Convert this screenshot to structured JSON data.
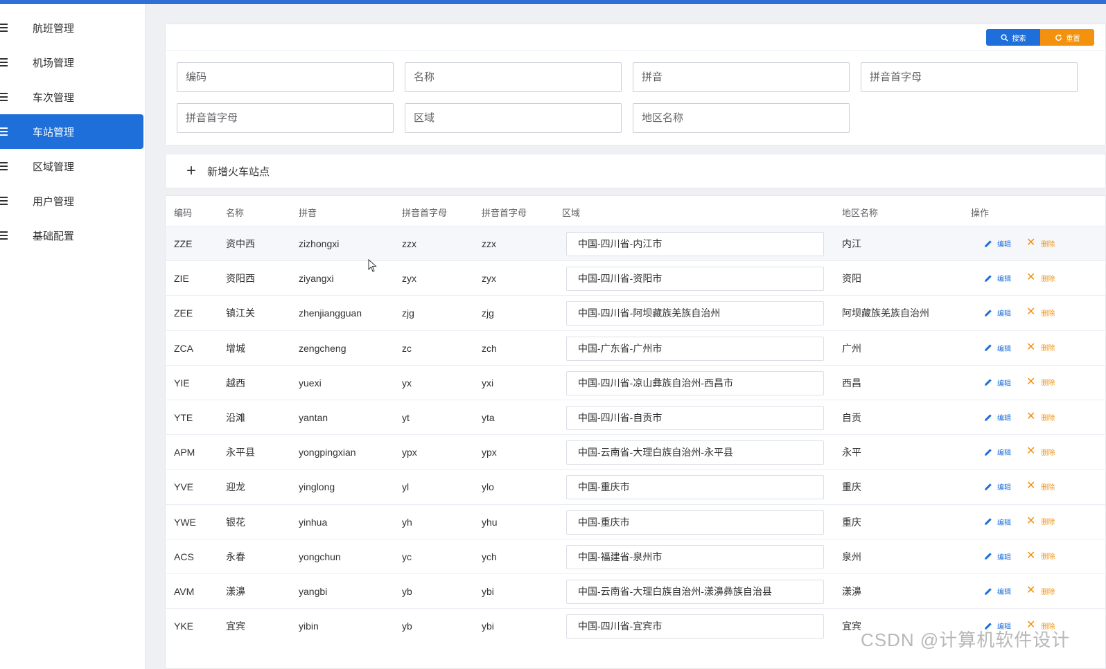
{
  "sidebar": {
    "items": [
      {
        "label": "航班管理"
      },
      {
        "label": "机场管理"
      },
      {
        "label": "车次管理"
      },
      {
        "label": "车站管理"
      },
      {
        "label": "区域管理"
      },
      {
        "label": "用户管理"
      },
      {
        "label": "基础配置"
      }
    ],
    "active_index": 3
  },
  "toolbar": {
    "search_label": "搜索",
    "reset_label": "重置",
    "search_icon": "search-icon",
    "reset_icon": "refresh-icon"
  },
  "filters": {
    "code_placeholder": "编码",
    "name_placeholder": "名称",
    "pinyin_placeholder": "拼音",
    "initials_placeholder": "拼音首字母",
    "initials2_placeholder": "拼音首字母",
    "region_placeholder": "区域",
    "area_name_placeholder": "地区名称"
  },
  "add_bar": {
    "label": "新增火车站点"
  },
  "table": {
    "columns": {
      "code": "编码",
      "name": "名称",
      "pinyin": "拼音",
      "initials": "拼音首字母",
      "initials2": "拼音首字母",
      "region": "区域",
      "area_name": "地区名称",
      "actions": "操作"
    },
    "edit_label": "编辑",
    "delete_label": "删除",
    "rows": [
      {
        "code": "ZZE",
        "name": "资中西",
        "pinyin": "zizhongxi",
        "initials": "zzx",
        "initials2": "zzx",
        "region": "中国-四川省-内江市",
        "area_name": "内江"
      },
      {
        "code": "ZIE",
        "name": "资阳西",
        "pinyin": "ziyangxi",
        "initials": "zyx",
        "initials2": "zyx",
        "region": "中国-四川省-资阳市",
        "area_name": "资阳"
      },
      {
        "code": "ZEE",
        "name": "镇江关",
        "pinyin": "zhenjiangguan",
        "initials": "zjg",
        "initials2": "zjg",
        "region": "中国-四川省-阿坝藏族羌族自治州",
        "area_name": "阿坝藏族羌族自治州"
      },
      {
        "code": "ZCA",
        "name": "增城",
        "pinyin": "zengcheng",
        "initials": "zc",
        "initials2": "zch",
        "region": "中国-广东省-广州市",
        "area_name": "广州"
      },
      {
        "code": "YIE",
        "name": "越西",
        "pinyin": "yuexi",
        "initials": "yx",
        "initials2": "yxi",
        "region": "中国-四川省-凉山彝族自治州-西昌市",
        "area_name": "西昌"
      },
      {
        "code": "YTE",
        "name": "沿滩",
        "pinyin": "yantan",
        "initials": "yt",
        "initials2": "yta",
        "region": "中国-四川省-自贡市",
        "area_name": "自贡"
      },
      {
        "code": "APM",
        "name": "永平县",
        "pinyin": "yongpingxian",
        "initials": "ypx",
        "initials2": "ypx",
        "region": "中国-云南省-大理白族自治州-永平县",
        "area_name": "永平"
      },
      {
        "code": "YVE",
        "name": "迎龙",
        "pinyin": "yinglong",
        "initials": "yl",
        "initials2": "ylo",
        "region": "中国-重庆市",
        "area_name": "重庆"
      },
      {
        "code": "YWE",
        "name": "银花",
        "pinyin": "yinhua",
        "initials": "yh",
        "initials2": "yhu",
        "region": "中国-重庆市",
        "area_name": "重庆"
      },
      {
        "code": "ACS",
        "name": "永春",
        "pinyin": "yongchun",
        "initials": "yc",
        "initials2": "ych",
        "region": "中国-福建省-泉州市",
        "area_name": "泉州"
      },
      {
        "code": "AVM",
        "name": "漾濞",
        "pinyin": "yangbi",
        "initials": "yb",
        "initials2": "ybi",
        "region": "中国-云南省-大理白族自治州-漾濞彝族自治县",
        "area_name": "漾濞"
      },
      {
        "code": "YKE",
        "name": "宜宾",
        "pinyin": "yibin",
        "initials": "yb",
        "initials2": "ybi",
        "region": "中国-四川省-宜宾市",
        "area_name": "宜宾"
      }
    ]
  },
  "watermark": "CSDN @计算机软件设计",
  "colors": {
    "primary": "#1e6fd9",
    "warning": "#f2920f"
  }
}
